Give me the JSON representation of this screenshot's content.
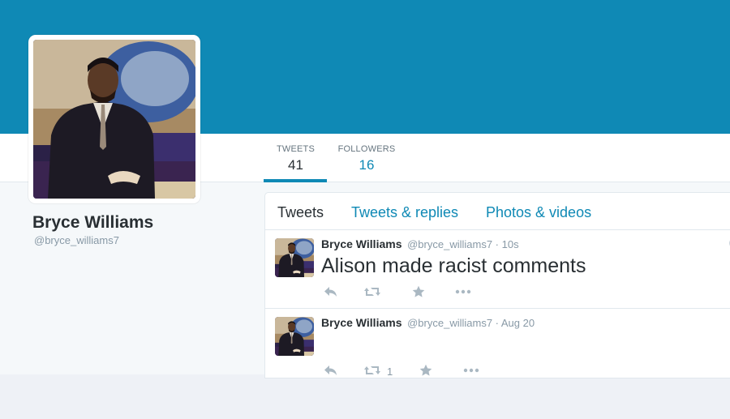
{
  "profile": {
    "name": "Bryce Williams",
    "handle": "@bryce_williams7"
  },
  "stats": {
    "tweets_label": "TWEETS",
    "tweets_count": "41",
    "followers_label": "FOLLOWERS",
    "followers_count": "16"
  },
  "tabs": {
    "tweets": "Tweets",
    "tweets_replies": "Tweets & replies",
    "photos_videos": "Photos & videos"
  },
  "timeline": [
    {
      "name": "Bryce Williams",
      "meta": "@bryce_williams7 · 10s",
      "text": "Alison made racist comments",
      "retweet_count": ""
    },
    {
      "name": "Bryce Williams",
      "meta": "@bryce_williams7 · Aug 20",
      "text": "",
      "retweet_count": "1"
    }
  ],
  "colors": {
    "brand": "#0f89b5",
    "icon_gray": "#aab8c2",
    "text": "#292f33",
    "muted": "#8899a6"
  },
  "icons": [
    "reply-icon",
    "retweet-icon",
    "favorite-star-icon",
    "more-dots-icon",
    "caret-icon"
  ]
}
